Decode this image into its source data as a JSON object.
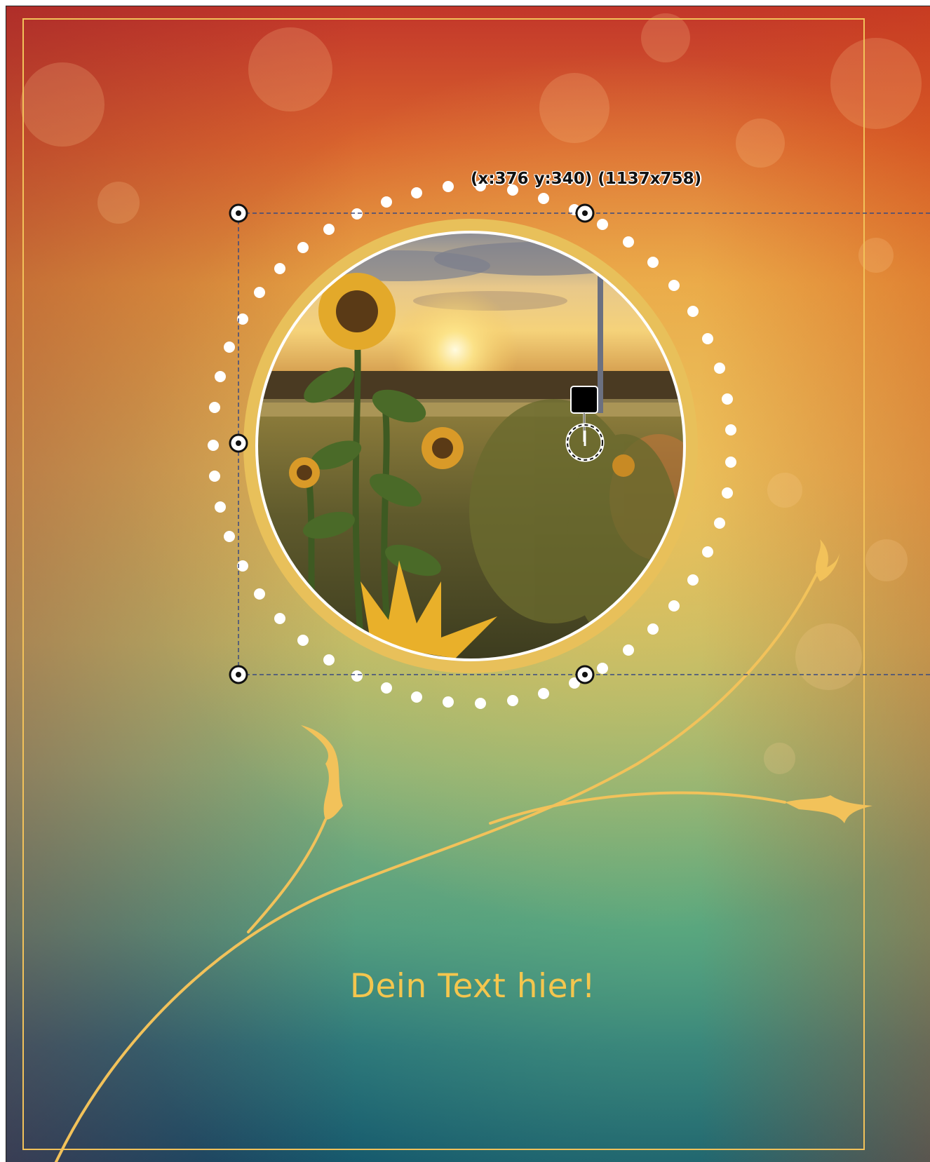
{
  "document": {
    "caption_text": "Dein Text hier!",
    "selection_info": "(x:376 y:340) (1137x758)"
  },
  "colors": {
    "accent_gold": "#f4c64e",
    "frame_line": "#f2c25a",
    "dots": "#ffffff",
    "selection_line": "#3a4a80"
  },
  "icons": {
    "resize_handle": "circle-target-icon",
    "move_handle": "black-square-icon",
    "rotate_handle": "dashed-circle-icon"
  }
}
